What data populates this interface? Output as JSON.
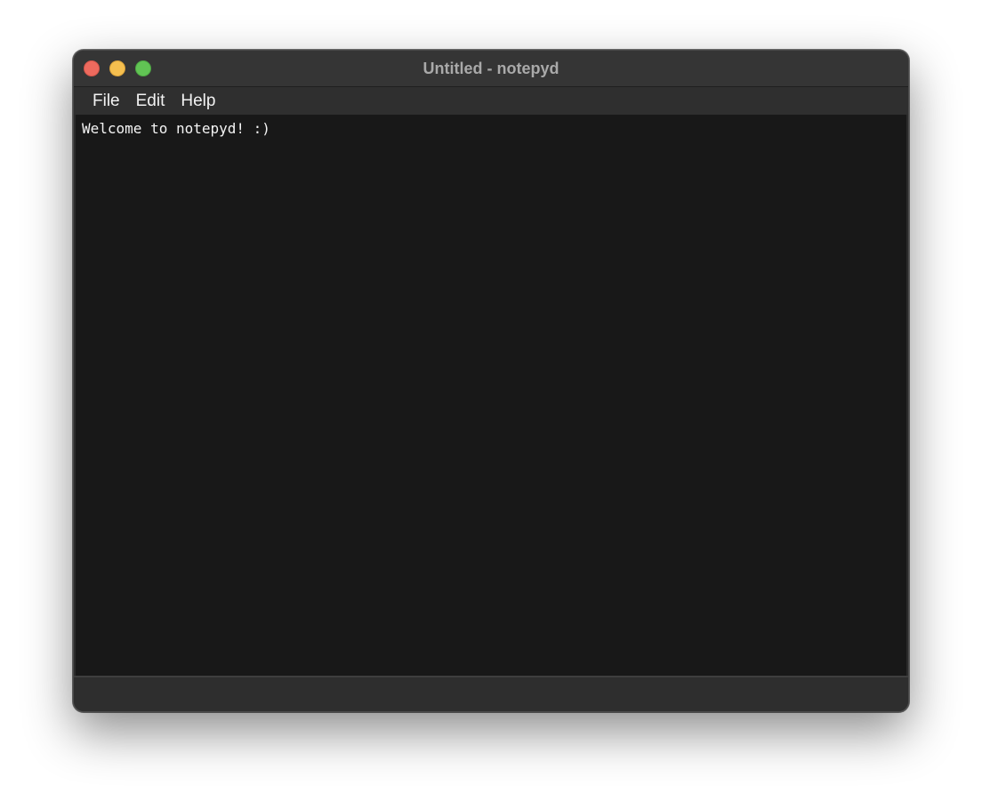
{
  "window": {
    "title": "Untitled - notepyd"
  },
  "menubar": {
    "items": [
      {
        "label": "File"
      },
      {
        "label": "Edit"
      },
      {
        "label": "Help"
      }
    ]
  },
  "editor": {
    "content": "Welcome to notepyd! :)"
  },
  "colors": {
    "close": "#ed6a5e",
    "minimize": "#f5bf4f",
    "zoom": "#61c454",
    "editor_background": "#181818",
    "titlebar": "#353535"
  }
}
